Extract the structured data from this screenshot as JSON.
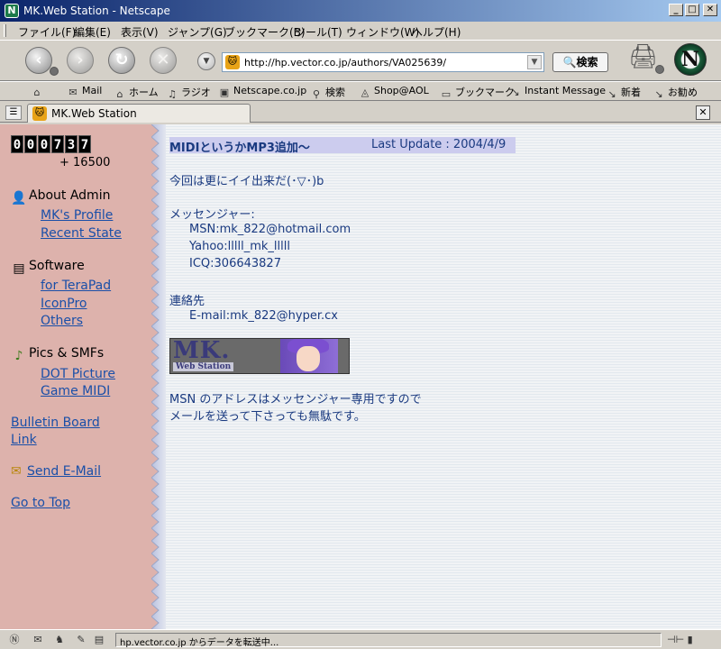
{
  "window": {
    "title": "MK.Web Station - Netscape",
    "app_icon": "N"
  },
  "menu": [
    "ファイル(F)",
    "編集(E)",
    "表示(V)",
    "ジャンプ(G)",
    "ブックマーク(B)",
    "ツール(T)",
    "ウィンドウ(W)",
    "ヘルプ(H)"
  ],
  "nav": {
    "url": "http://hp.vector.co.jp/authors/VA025639/",
    "search_label": "検索",
    "logo": "N"
  },
  "personal_toolbar": [
    "Mail",
    "ホーム",
    "ラジオ",
    "Netscape.co.jp",
    "検索",
    "Shop@AOL",
    "ブックマーク",
    "Instant Message",
    "新着",
    "お勧め"
  ],
  "tab": {
    "label": "MK.Web Station"
  },
  "page": {
    "counter": [
      "0",
      "0",
      "0",
      "7",
      "3",
      "7"
    ],
    "counter_sub": "+ 16500",
    "sidebar": {
      "about_head": "About Admin",
      "about_links": [
        "MK's Profile",
        "Recent State"
      ],
      "software_head": "Software",
      "software_links": [
        "for TeraPad",
        "IconPro",
        "Others"
      ],
      "pics_head": "Pics & SMFs",
      "pics_links": [
        "DOT Picture",
        "Game MIDI"
      ],
      "bulletin": "Bulletin Board",
      "link": "Link",
      "send_email": "Send E-Mail",
      "go_top": "Go to Top"
    },
    "content": {
      "title": "MIDIというかMP3追加～",
      "last_update": "Last Update : 2004/4/9",
      "intro": "今回は更にイイ出来だ(･▽･)b",
      "messenger_head": "メッセンジャー:",
      "msn": "MSN:mk_822@hotmail.com",
      "yahoo": "Yahoo:lllll_mk_lllll",
      "icq": "ICQ:306643827",
      "contact_head": "連絡先",
      "email": "E-mail:mk_822@hyper.cx",
      "banner_main": "MK.",
      "banner_sub": "Web Station",
      "note1": "MSN のアドレスはメッセンジャー専用ですので",
      "note2": "メールを送って下さっても無駄です。"
    }
  },
  "status": {
    "text": "hp.vector.co.jp からデータを転送中..."
  }
}
